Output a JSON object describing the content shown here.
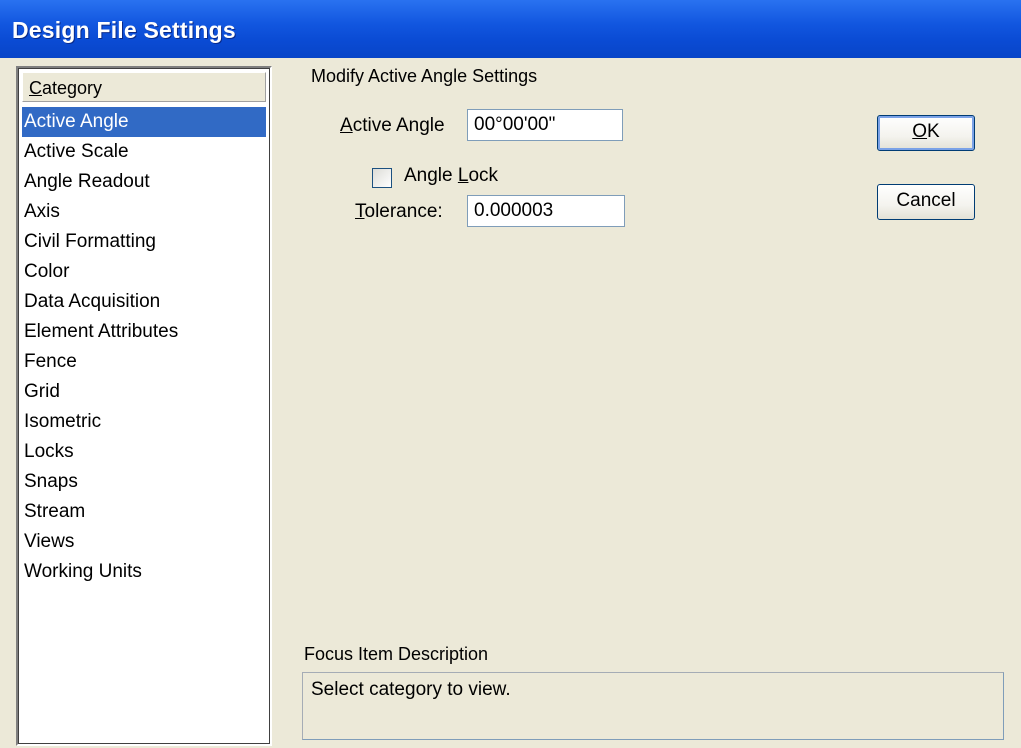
{
  "window": {
    "title": "Design File Settings"
  },
  "category": {
    "header": "Category",
    "header_mnemonic": "C",
    "header_rest": "ategory",
    "items": [
      {
        "label": "Active Angle",
        "selected": true
      },
      {
        "label": "Active Scale",
        "selected": false
      },
      {
        "label": "Angle Readout",
        "selected": false
      },
      {
        "label": "Axis",
        "selected": false
      },
      {
        "label": "Civil Formatting",
        "selected": false
      },
      {
        "label": "Color",
        "selected": false
      },
      {
        "label": "Data Acquisition",
        "selected": false
      },
      {
        "label": "Element Attributes",
        "selected": false
      },
      {
        "label": "Fence",
        "selected": false
      },
      {
        "label": "Grid",
        "selected": false
      },
      {
        "label": "Isometric",
        "selected": false
      },
      {
        "label": "Locks",
        "selected": false
      },
      {
        "label": "Snaps",
        "selected": false
      },
      {
        "label": "Stream",
        "selected": false
      },
      {
        "label": "Views",
        "selected": false
      },
      {
        "label": "Working Units",
        "selected": false
      }
    ]
  },
  "settings": {
    "section_title": "Modify Active Angle Settings",
    "active_angle": {
      "label_mnemonic": "A",
      "label_rest": "ctive Angle",
      "value": "00°00'00\""
    },
    "angle_lock": {
      "label_pre": "Angle ",
      "label_mnemonic": "L",
      "label_post": "ock",
      "checked": false
    },
    "tolerance": {
      "label_mnemonic": "T",
      "label_rest": "olerance:",
      "value": "0.000003"
    }
  },
  "buttons": {
    "ok_mnemonic": "O",
    "ok_rest": "K",
    "cancel": "Cancel"
  },
  "focus": {
    "label": "Focus Item Description",
    "text": "Select category to view."
  },
  "colors": {
    "titlebar": "#0a4bd4",
    "selection": "#316ac5",
    "dialog_bg": "#ece9d8"
  }
}
